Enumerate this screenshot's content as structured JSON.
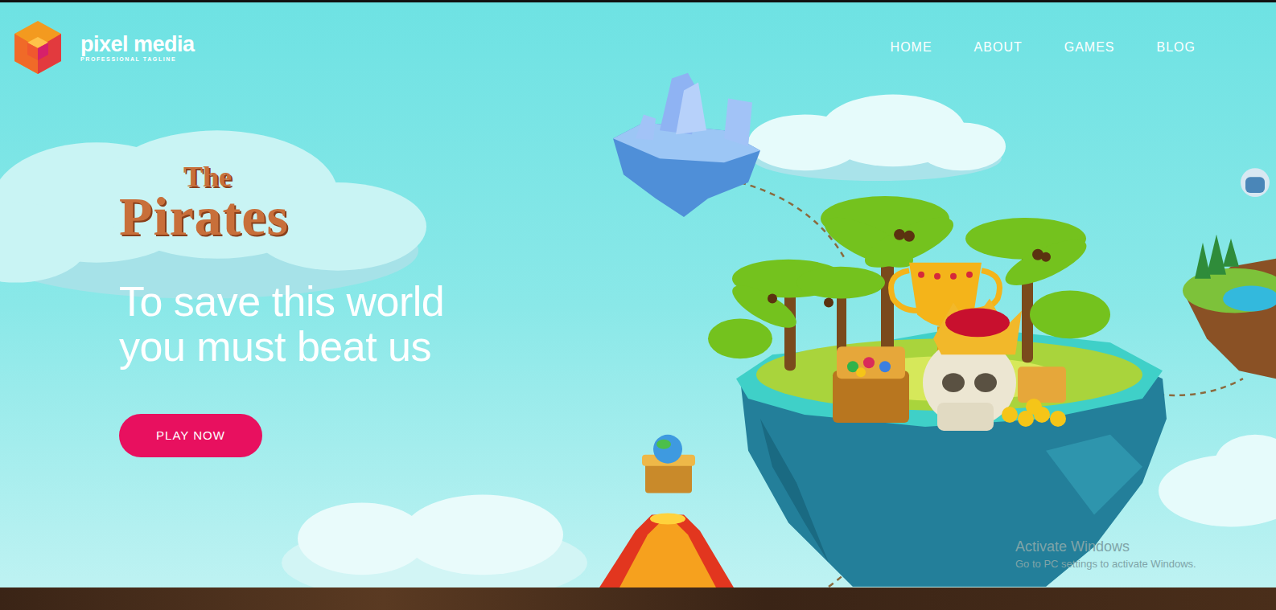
{
  "header": {
    "logo": {
      "name": "pixel media",
      "tagline": "PROFESSIONAL TAGLINE"
    },
    "nav": [
      {
        "label": "HOME"
      },
      {
        "label": "ABOUT"
      },
      {
        "label": "GAMES"
      },
      {
        "label": "BLOG"
      }
    ]
  },
  "hero": {
    "title": {
      "small": "The",
      "large": "Pirates"
    },
    "headline": [
      "To save this world",
      "you must beat us"
    ],
    "button": "PLAY NOW"
  },
  "watermark": {
    "title": "Activate Windows",
    "subtitle": "Go to PC settings to activate Windows."
  }
}
